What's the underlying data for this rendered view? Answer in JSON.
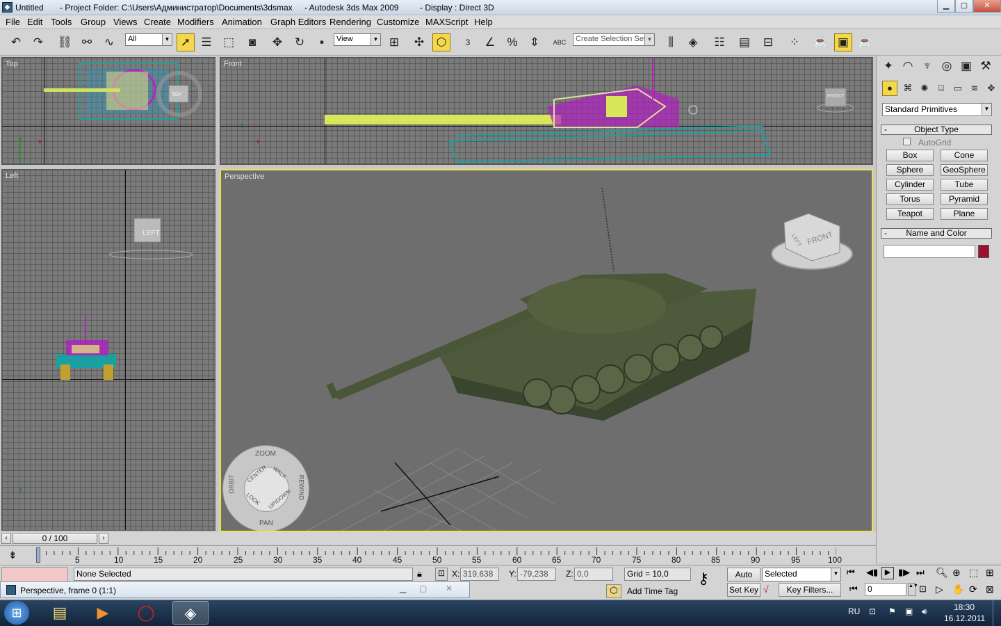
{
  "window": {
    "doc_name": "Untitled",
    "project": "- Project Folder: C:\\Users\\Администратор\\Documents\\3dsmax",
    "app": "- Autodesk 3ds Max  2009",
    "display": "- Display : Direct 3D"
  },
  "menu": [
    "File",
    "Edit",
    "Tools",
    "Group",
    "Views",
    "Create",
    "Modifiers",
    "Animation",
    "Graph Editors",
    "Rendering",
    "Customize",
    "MAXScript",
    "Help"
  ],
  "toolbar": {
    "filter_value": "All",
    "refcoord_value": "View",
    "selection_set_placeholder": "Create Selection Set",
    "snap_3": "3",
    "abc": "ABC"
  },
  "viewports": {
    "top": "Top",
    "front": "Front",
    "left": "Left",
    "perspective": "Perspective",
    "viewcube_top": "TOP",
    "viewcube_front": "FRONT",
    "viewcube_left": "LEFT",
    "persp_cube_front": "FRONT",
    "persp_cube_left": "LEFT"
  },
  "steering_wheel": {
    "zoom": "ZOOM",
    "orbit": "ORBIT",
    "pan": "PAN",
    "rewind": "REWIND",
    "center": "CENTER",
    "walk": "WALK",
    "look": "LOOK",
    "updown": "UP/DOWN",
    "close": "×"
  },
  "command_panel": {
    "category": "Standard Primitives",
    "object_type_title": "Object Type",
    "autogrid": "AutoGrid",
    "buttons": [
      "Box",
      "Cone",
      "Sphere",
      "GeoSphere",
      "Cylinder",
      "Tube",
      "Torus",
      "Pyramid",
      "Teapot",
      "Plane"
    ],
    "name_color_title": "Name and Color",
    "name_value": "",
    "color": "#9b1030",
    "rollout_collapse": "-"
  },
  "timeline": {
    "frame_display": "0 / 100",
    "ticks": [
      "5",
      "10",
      "15",
      "20",
      "25",
      "30",
      "35",
      "40",
      "45",
      "50",
      "55",
      "60",
      "65",
      "70",
      "75",
      "80",
      "85",
      "90",
      "95",
      "100"
    ]
  },
  "status": {
    "selection": "None Selected",
    "x_label": "X:",
    "x_value": "319,638",
    "y_label": "Y:",
    "y_value": "-79,238",
    "z_label": "Z:",
    "z_value": "0,0",
    "grid": "Grid = 10,0",
    "auto_key": "Auto Key",
    "key_mode": "Selected",
    "set_key": "Set Key",
    "key_filters": "Key Filters...",
    "add_time_tag": "Add Time Tag",
    "frame_field": "0"
  },
  "popup": {
    "title": "Perspective, frame 0 (1:1)"
  },
  "taskbar": {
    "lang": "RU",
    "time": "18:30",
    "date": "16.12.2011"
  }
}
